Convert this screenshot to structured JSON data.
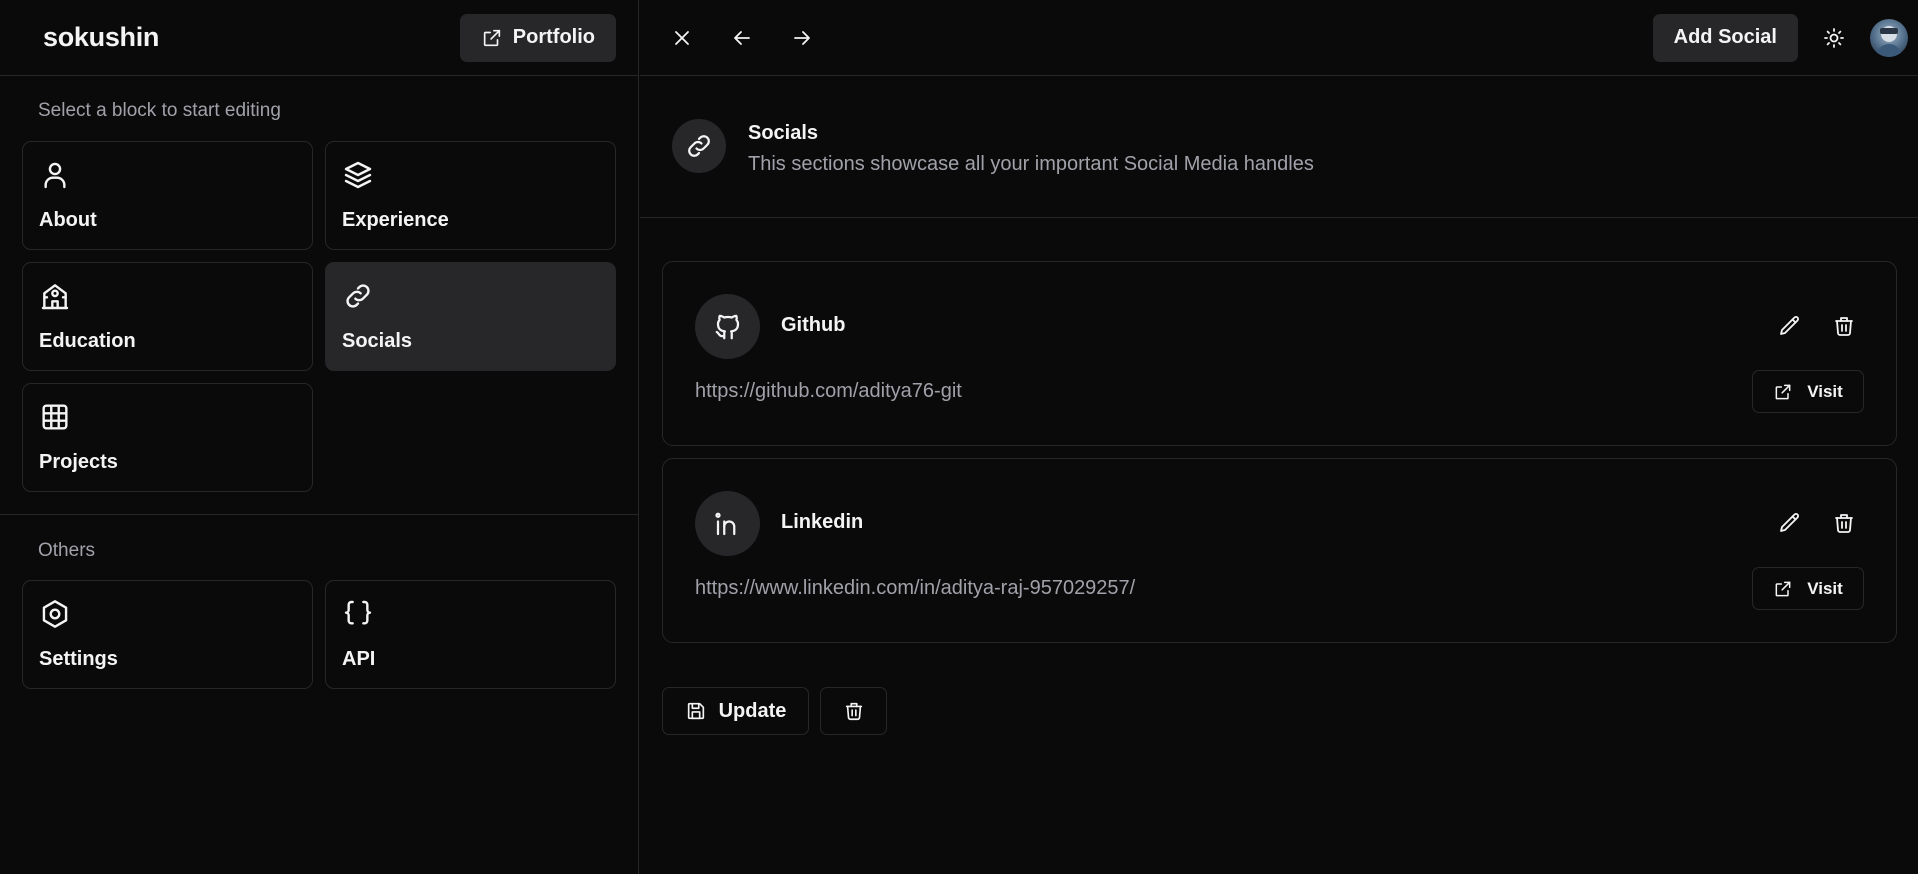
{
  "app": {
    "brand": "sokushin",
    "portfolio_label": "Portfolio"
  },
  "sidebar": {
    "select_label": "Select a block to start editing",
    "blocks": [
      {
        "label": "About",
        "icon": "user-icon",
        "active": false
      },
      {
        "label": "Experience",
        "icon": "layers-icon",
        "active": false
      },
      {
        "label": "Education",
        "icon": "school-icon",
        "active": false
      },
      {
        "label": "Socials",
        "icon": "link-icon",
        "active": true
      },
      {
        "label": "Projects",
        "icon": "grid-icon",
        "active": false
      }
    ],
    "others_label": "Others",
    "others": [
      {
        "label": "Settings",
        "icon": "hexagon-icon"
      },
      {
        "label": "API",
        "icon": "braces-icon"
      }
    ]
  },
  "header": {
    "add_label": "Add Social",
    "icons": [
      "close-icon",
      "arrow-left-icon",
      "arrow-right-icon",
      "sun-icon",
      "avatar"
    ]
  },
  "section": {
    "title": "Socials",
    "description": "This sections showcase all your important Social Media handles"
  },
  "socials": [
    {
      "name": "Github",
      "url": "https://github.com/aditya76-git",
      "icon": "github-icon",
      "visit_label": "Visit"
    },
    {
      "name": "Linkedin",
      "url": "https://www.linkedin.com/in/aditya-raj-957029257/",
      "icon": "linkedin-icon",
      "visit_label": "Visit"
    }
  ],
  "footer": {
    "update_label": "Update"
  },
  "colors": {
    "background": "#0a0a0b",
    "surface": "#27272a",
    "muted_text": "#a1a1aa",
    "text": "#f4f4f5"
  }
}
